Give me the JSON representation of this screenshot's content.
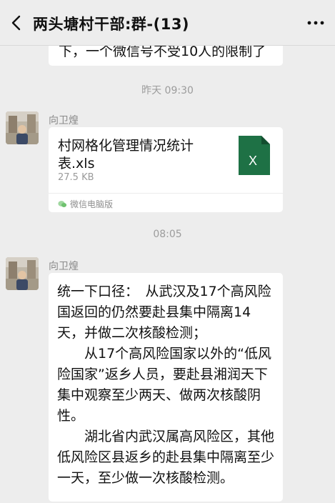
{
  "header": {
    "title": "两头塘村干部:群-(13)",
    "back_icon": "chevron-left-icon",
    "more_icon": "more-dots-icon"
  },
  "messages": {
    "partial_text": "下，一个微信号不受10人的限制了",
    "timestamp_1": "昨天 09:30",
    "sender_1": "向卫煌",
    "file": {
      "name": "村网格化管理情况统计表.xls",
      "size": "27.5 KB",
      "icon_label": "X",
      "source": "微信电脑版",
      "icon_color": "#1e7145"
    },
    "timestamp_2": "08:05",
    "sender_2": "向卫煌",
    "text_paragraphs": [
      "统一下口径：　从武汉及17个高风险国返回的仍然要赴县集中隔离14天，并做二次核酸检测；",
      "从17个高风险国家以外的“低风险国家”返乡人员，要赴县湘润天下集中观察至少两天、做两次核酸阴性。",
      "湖北省内武汉属高风险区，其他低风险区县返乡的赴县集中隔离至少一天，至少做一次核酸检测。"
    ]
  }
}
